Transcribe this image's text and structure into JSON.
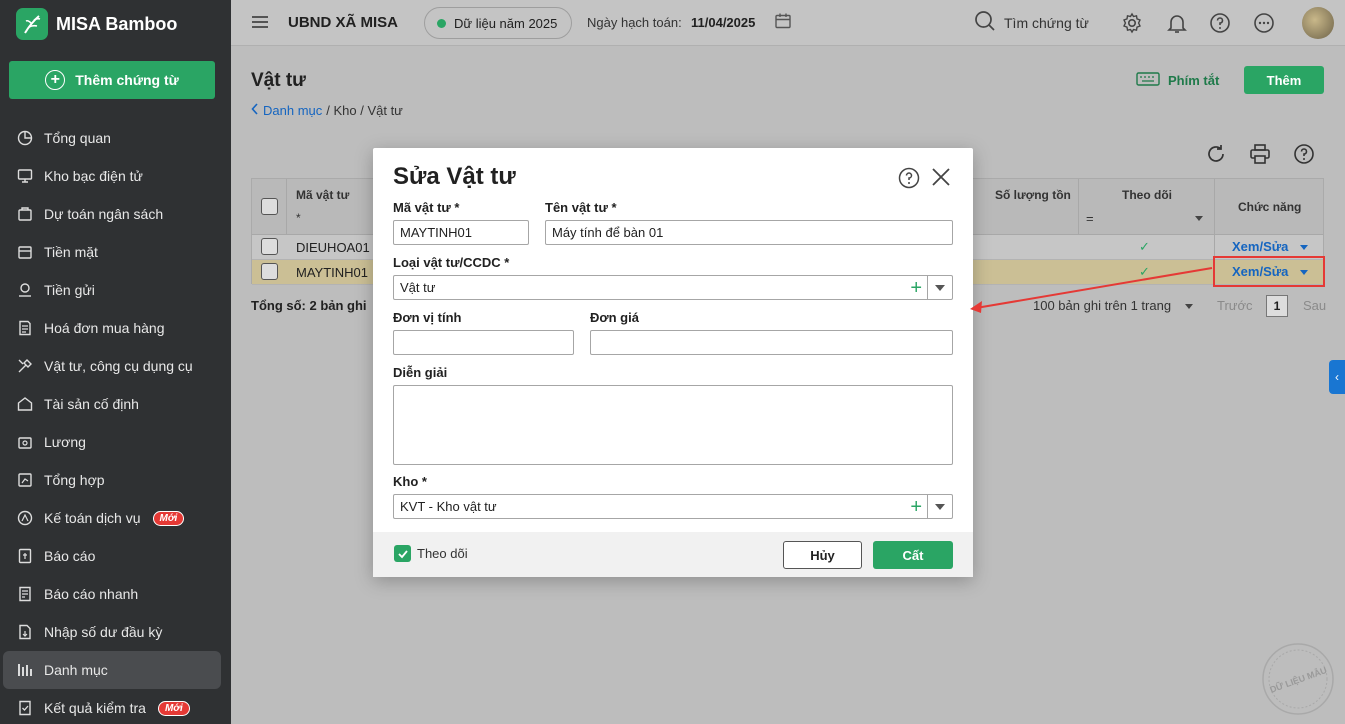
{
  "app": {
    "name": "MISA Bamboo",
    "add_voucher": "Thêm chứng từ"
  },
  "sidebar": {
    "items": [
      {
        "label": "Tổng quan",
        "icon": "pie-chart-icon"
      },
      {
        "label": "Kho bạc điện tử",
        "icon": "monitor-icon"
      },
      {
        "label": "Dự toán ngân sách",
        "icon": "budget-icon"
      },
      {
        "label": "Tiền mặt",
        "icon": "cash-icon"
      },
      {
        "label": "Tiền gửi",
        "icon": "deposit-icon"
      },
      {
        "label": "Hoá đơn mua hàng",
        "icon": "invoice-icon"
      },
      {
        "label": "Vật tư, công cụ dụng cụ",
        "icon": "tools-icon"
      },
      {
        "label": "Tài sản cố định",
        "icon": "asset-icon"
      },
      {
        "label": "Lương",
        "icon": "salary-icon"
      },
      {
        "label": "Tổng hợp",
        "icon": "summary-icon"
      },
      {
        "label": "Kế toán dịch vụ",
        "icon": "service-icon",
        "badge": "Mới"
      },
      {
        "label": "Báo cáo",
        "icon": "report-icon"
      },
      {
        "label": "Báo cáo nhanh",
        "icon": "quick-report-icon"
      },
      {
        "label": "Nhập số dư đầu kỳ",
        "icon": "opening-balance-icon"
      },
      {
        "label": "Danh mục",
        "icon": "catalog-icon",
        "active": true
      },
      {
        "label": "Kết quả kiểm tra",
        "icon": "check-result-icon",
        "badge": "Mới"
      }
    ]
  },
  "header": {
    "org": "UBND XÃ MISA",
    "data_year": "Dữ liệu năm 2025",
    "acc_date_label": "Ngày hạch toán:",
    "acc_date_value": "11/04/2025",
    "search_label": "Tìm chứng từ"
  },
  "page": {
    "title": "Vật tư",
    "breadcrumb_link": "Danh mục",
    "breadcrumb_rest": "/ Kho / Vật tư",
    "shortcut": "Phím tắt",
    "add": "Thêm"
  },
  "grid": {
    "columns": {
      "code": "Mã vật tư",
      "qty": "Số lượng tồn",
      "track": "Theo dõi",
      "action": "Chức năng"
    },
    "filter_code": "*",
    "filter_track": "=",
    "rows": [
      {
        "code": "DIEUHOA01",
        "action": "Xem/Sửa"
      },
      {
        "code": "MAYTINH01",
        "action": "Xem/Sửa"
      }
    ],
    "total": "Tổng số: 2 bản ghi",
    "per_page": "100 bản ghi trên 1 trang",
    "prev": "Trước",
    "page": "1",
    "next": "Sau"
  },
  "modal": {
    "title": "Sửa Vật tư",
    "code_label": "Mã vật tư *",
    "code_value": "MAYTINH01",
    "name_label": "Tên vật tư *",
    "name_value": "Máy tính để bàn 01",
    "type_label": "Loại vật tư/CCDC *",
    "type_value": "Vật tư",
    "unit_label": "Đơn vị tính",
    "unit_value": "",
    "price_label": "Đơn giá",
    "price_value": "",
    "desc_label": "Diễn giải",
    "desc_value": "",
    "warehouse_label": "Kho *",
    "warehouse_value": "KVT - Kho vật tư",
    "track_label": "Theo dõi",
    "cancel": "Hủy",
    "save": "Cất"
  },
  "watermark": "DỮ LIỆU MẪU"
}
